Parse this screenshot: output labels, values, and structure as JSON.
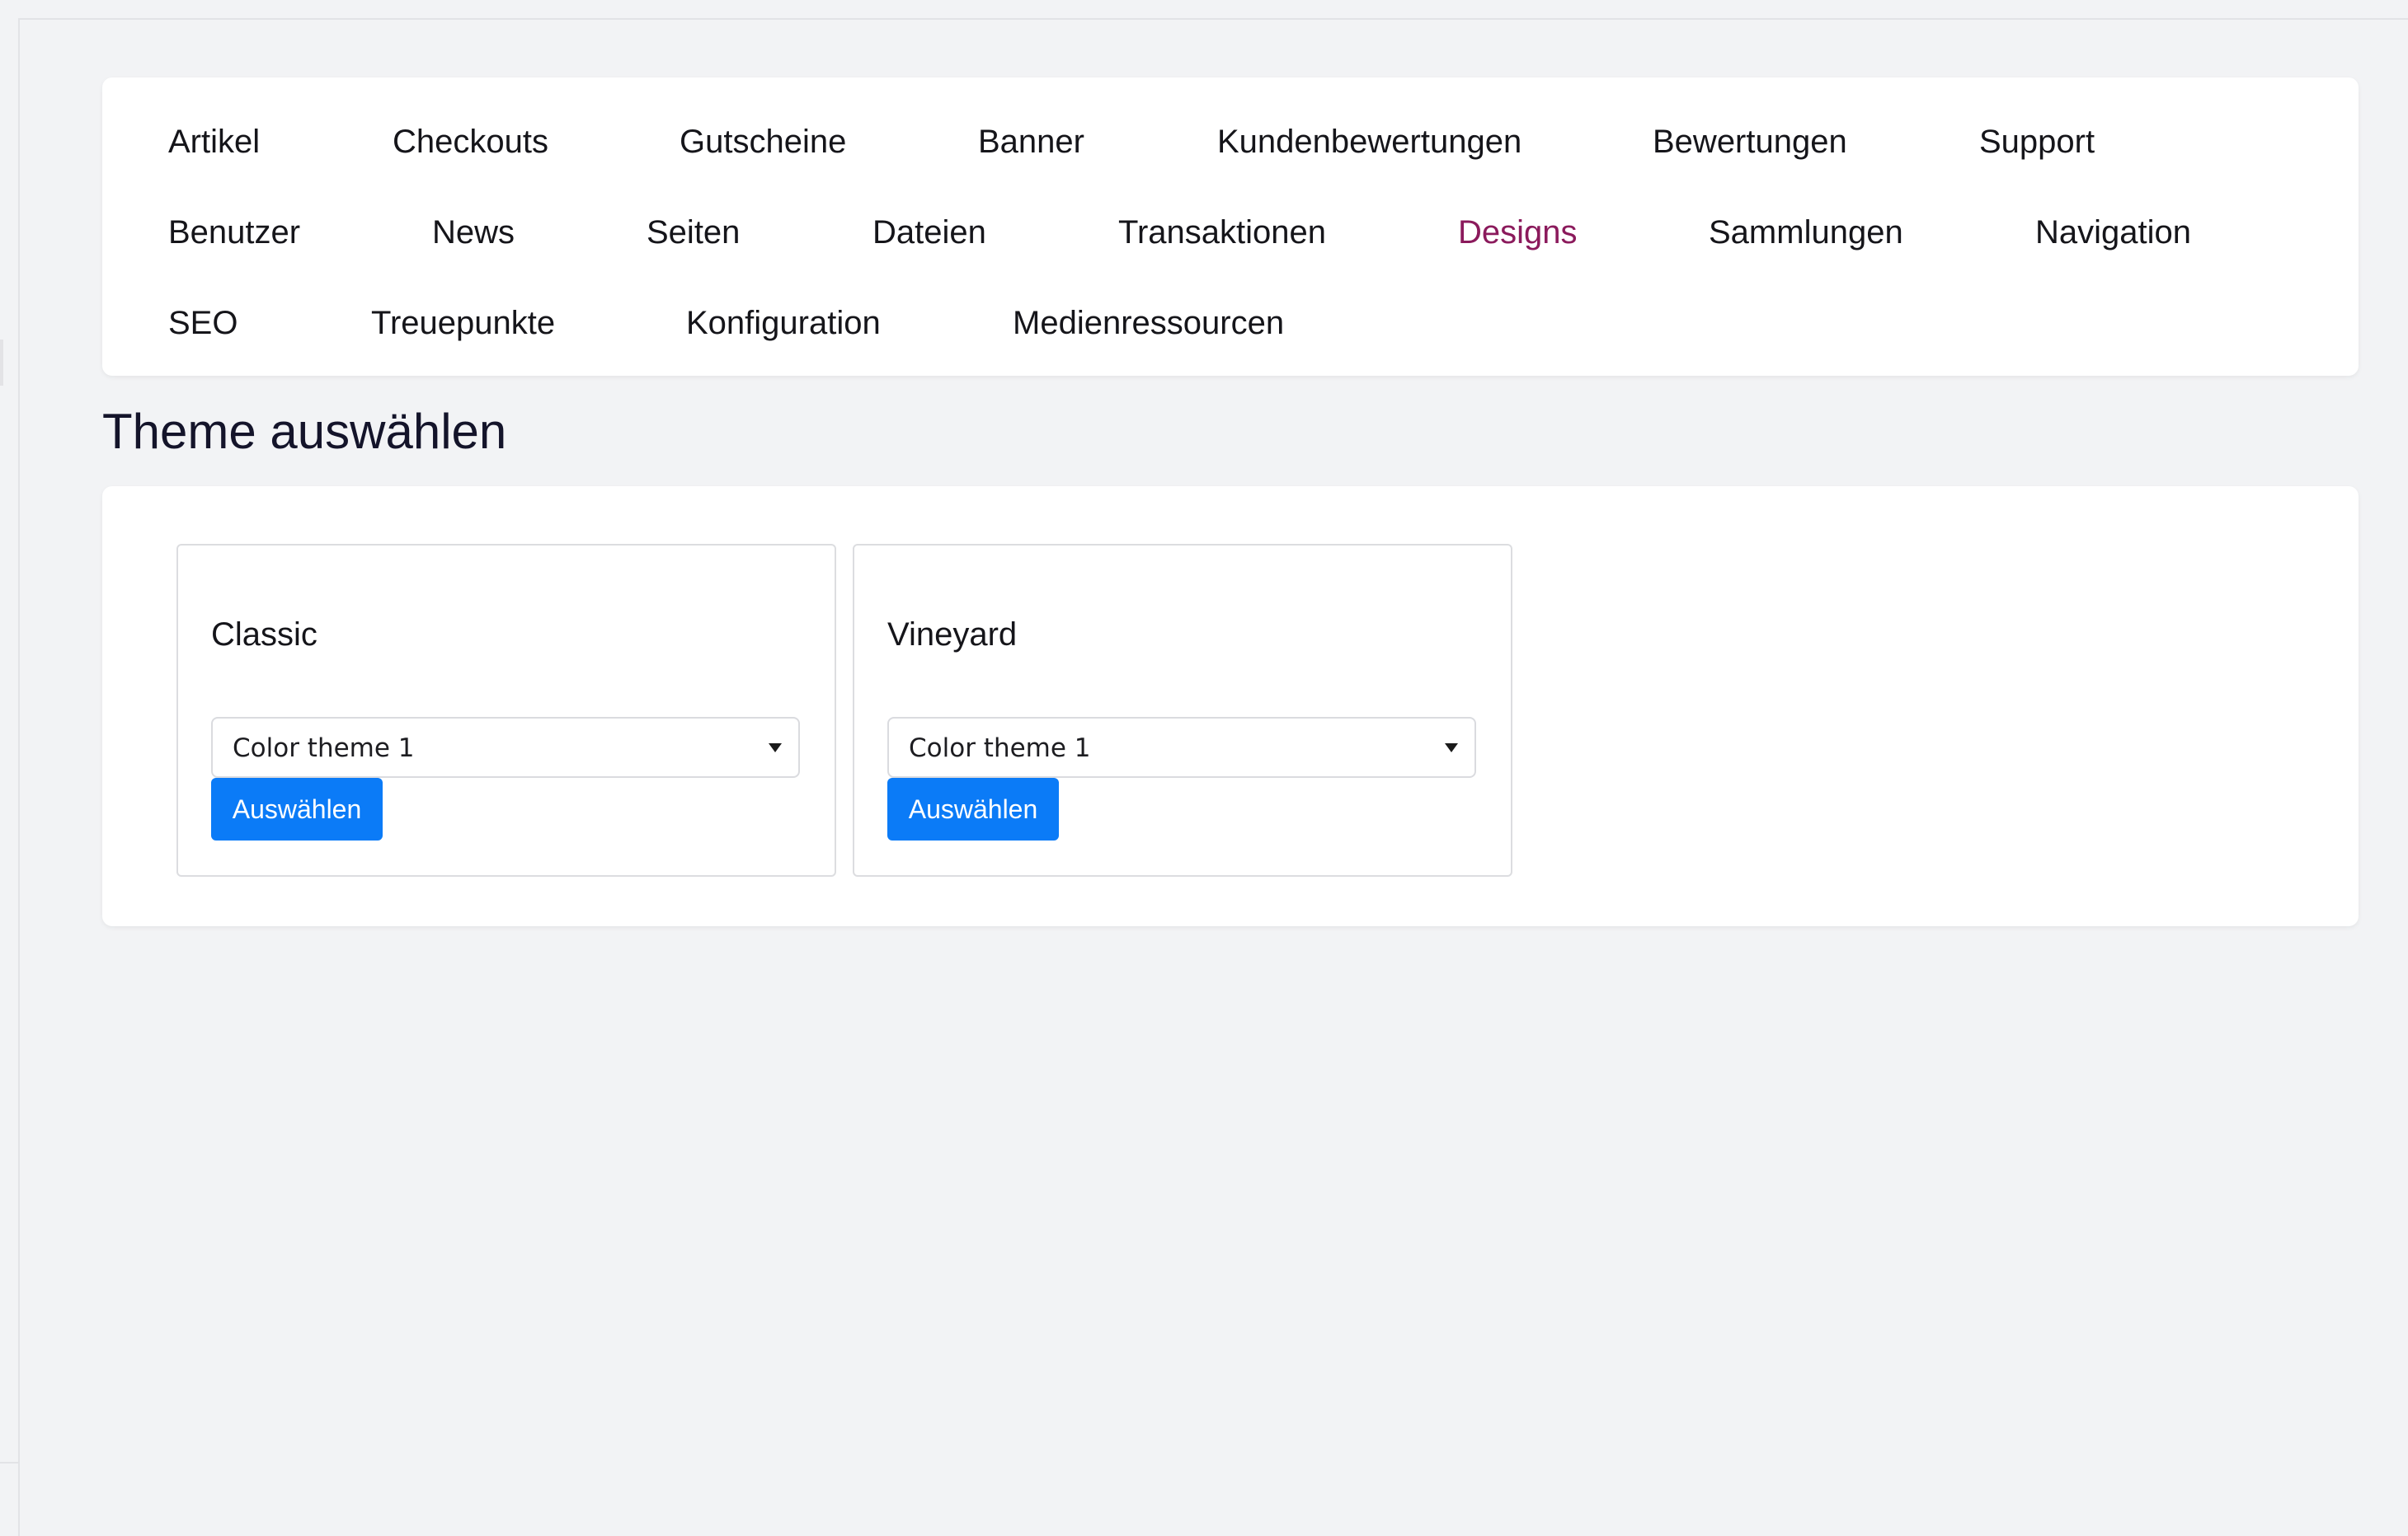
{
  "nav": {
    "items": [
      {
        "label": "Artikel",
        "active": false
      },
      {
        "label": "Checkouts",
        "active": false
      },
      {
        "label": "Gutscheine",
        "active": false
      },
      {
        "label": "Banner",
        "active": false
      },
      {
        "label": "Kundenbewertungen",
        "active": false
      },
      {
        "label": "Bewertungen",
        "active": false
      },
      {
        "label": "Support",
        "active": false
      },
      {
        "label": "Benutzer",
        "active": false
      },
      {
        "label": "News",
        "active": false
      },
      {
        "label": "Seiten",
        "active": false
      },
      {
        "label": "Dateien",
        "active": false
      },
      {
        "label": "Transaktionen",
        "active": false
      },
      {
        "label": "Designs",
        "active": true
      },
      {
        "label": "Sammlungen",
        "active": false
      },
      {
        "label": "Navigation",
        "active": false
      },
      {
        "label": "SEO",
        "active": false
      },
      {
        "label": "Treuepunkte",
        "active": false
      },
      {
        "label": "Konfiguration",
        "active": false
      },
      {
        "label": "Medienressourcen",
        "active": false
      }
    ],
    "active_color": "#8b1a5c"
  },
  "page": {
    "title": "Theme auswählen"
  },
  "themes": [
    {
      "name": "Classic",
      "selected_color_theme": "Color theme 1",
      "button_label": "Auswählen"
    },
    {
      "name": "Vineyard",
      "selected_color_theme": "Color theme 1",
      "button_label": "Auswählen"
    }
  ],
  "colors": {
    "primary_button": "#0b7bf7",
    "background": "#f2f3f5"
  }
}
